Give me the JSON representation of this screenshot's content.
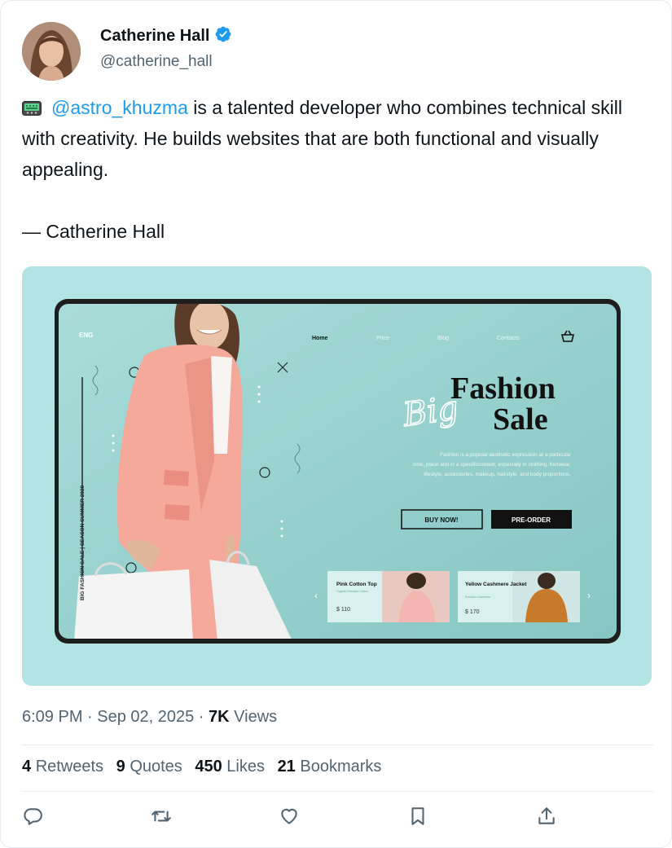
{
  "author": {
    "name": "Catherine Hall",
    "handle": "@catherine_hall"
  },
  "tweet": {
    "mention": "@astro_khuzma",
    "body": " is a talented developer who combines technical skill with creativity. He builds websites that are both functional and visually appealing.",
    "signature": "— Catherine Hall"
  },
  "mockup": {
    "nav": {
      "lang": "ENG",
      "home": "Home",
      "price": "Price",
      "blog": "Blog",
      "contacts": "Contacts"
    },
    "vertical_text": "BIG FASHION SALE | SEASON SUMMER 2020",
    "headline_1": "Fashion",
    "headline_2": "Sale",
    "script_word": "Big",
    "description": [
      "Fashion is a popular aesthetic expression at a particular",
      "time, place and in a specificcontext, especially in clothing, footwear,",
      "lifestyle, accessories, makeup, hairstyle, and body proportions."
    ],
    "buy_button": "BUY NOW!",
    "preorder_button": "PRE-ORDER",
    "products": [
      {
        "title": "Pink Cotton Top",
        "sub": "Organic Premium Cotton",
        "price": "$ 110"
      },
      {
        "title": "Yellow Cashmere Jacket",
        "sub": "Premium Cashmere",
        "price": "$ 170"
      }
    ]
  },
  "meta": {
    "time": "6:09 PM · Sep 02, 2025",
    "sep": " · ",
    "views_count": "7K",
    "views_label": " Views"
  },
  "stats": {
    "retweets_count": "4",
    "retweets_label": "Retweets",
    "quotes_count": "9",
    "quotes_label": "Quotes",
    "likes_count": "450",
    "likes_label": "Likes",
    "bookmarks_count": "21",
    "bookmarks_label": "Bookmarks"
  },
  "colors": {
    "accent": "#1d9bf0",
    "media_bg": "#b1e4e2",
    "screen_bg": "#8fcfcc",
    "blazer": "#f4a99a"
  },
  "icons": [
    "verified-badge-icon",
    "pager-emoji-icon",
    "reply-icon",
    "retweet-icon",
    "like-icon",
    "bookmark-icon",
    "share-icon"
  ]
}
